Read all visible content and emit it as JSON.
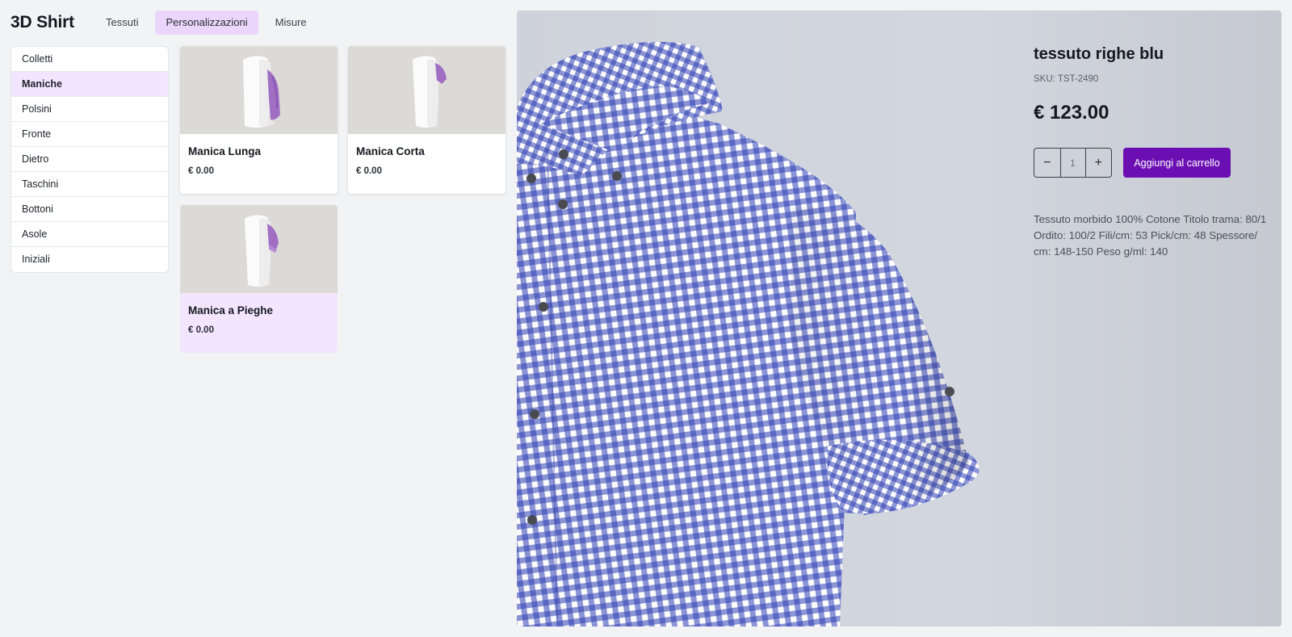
{
  "header": {
    "brand": "3D Shirt",
    "tabs": [
      {
        "label": "Tessuti",
        "active": false
      },
      {
        "label": "Personalizzazioni",
        "active": true
      },
      {
        "label": "Misure",
        "active": false
      }
    ]
  },
  "sidebar": {
    "items": [
      {
        "label": "Colletti",
        "active": false
      },
      {
        "label": "Maniche",
        "active": true
      },
      {
        "label": "Polsini",
        "active": false
      },
      {
        "label": "Fronte",
        "active": false
      },
      {
        "label": "Dietro",
        "active": false
      },
      {
        "label": "Taschini",
        "active": false
      },
      {
        "label": "Bottoni",
        "active": false
      },
      {
        "label": "Asole",
        "active": false
      },
      {
        "label": "Iniziali",
        "active": false
      }
    ]
  },
  "options": [
    {
      "name": "Manica Lunga",
      "price": "€ 0.00",
      "selected": false,
      "icon": "long-sleeve-shirt-icon"
    },
    {
      "name": "Manica Corta",
      "price": "€ 0.00",
      "selected": false,
      "icon": "short-sleeve-shirt-icon"
    },
    {
      "name": "Manica a Pieghe",
      "price": "€ 0.00",
      "selected": true,
      "icon": "rolled-sleeve-shirt-icon"
    }
  ],
  "product": {
    "title": "tessuto righe blu",
    "sku": "SKU: TST-2490",
    "price": "€ 123.00",
    "quantity": "1",
    "add_to_cart": "Aggiungi al carrello",
    "description": "Tessuto morbido 100% Cotone Titolo trama: 80/1 Ordito: 100/2 Fili/cm: 53 Pick/cm: 48 Spessore/ cm: 148-150 Peso g/ml: 140"
  },
  "colors": {
    "accent": "#6b0fb3",
    "highlight": "#f3e5fd",
    "sleeve": "#a06fc4",
    "fabric_blue": "#2f3fb5"
  }
}
